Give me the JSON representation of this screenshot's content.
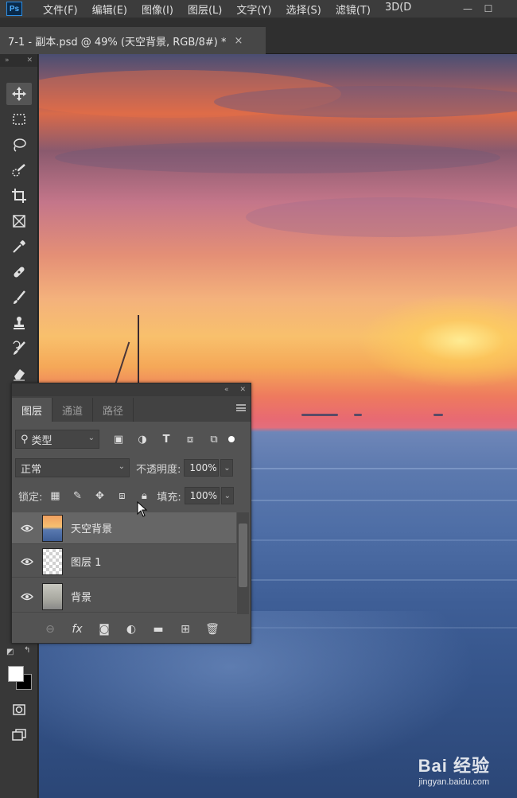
{
  "menubar": {
    "logo": "Ps",
    "items": [
      "文件(F)",
      "编辑(E)",
      "图像(I)",
      "图层(L)",
      "文字(Y)",
      "选择(S)",
      "滤镜(T)",
      "3D(D"
    ]
  },
  "document": {
    "tab_title": "7-1 - 副本.psd @ 49% (天空背景, RGB/8#) *",
    "close_glyph": "×"
  },
  "toolbar": {
    "tools": [
      "move-tool",
      "marquee-tool",
      "lasso-tool",
      "quick-selection-tool",
      "crop-tool",
      "frame-tool",
      "eyedropper-tool",
      "healing-brush-tool",
      "brush-tool",
      "clone-stamp-tool",
      "history-brush-tool",
      "eraser-tool"
    ],
    "active_tool": "move-tool",
    "foreground_color": "#ffffff",
    "background_color": "#000000"
  },
  "layers_panel": {
    "tabs": [
      "图层",
      "通道",
      "路径"
    ],
    "active_tab": "图层",
    "filter_kind": "类型",
    "blend_mode": "正常",
    "opacity_label": "不透明度:",
    "opacity_value": "100%",
    "lock_label": "锁定:",
    "fill_label": "填充:",
    "fill_value": "100%",
    "layers": [
      {
        "name": "天空背景",
        "visible": true,
        "selected": true
      },
      {
        "name": "图层 1",
        "visible": true,
        "selected": false
      },
      {
        "name": "背景",
        "visible": true,
        "selected": false
      }
    ],
    "bottom_icons": [
      "link-icon",
      "fx-icon",
      "mask-icon",
      "adjustment-icon",
      "folder-icon",
      "new-layer-icon",
      "trash-icon"
    ],
    "fx_label": "fx"
  },
  "watermark": {
    "main": "Bai 经验",
    "sub": "jingyan.baidu.com"
  }
}
